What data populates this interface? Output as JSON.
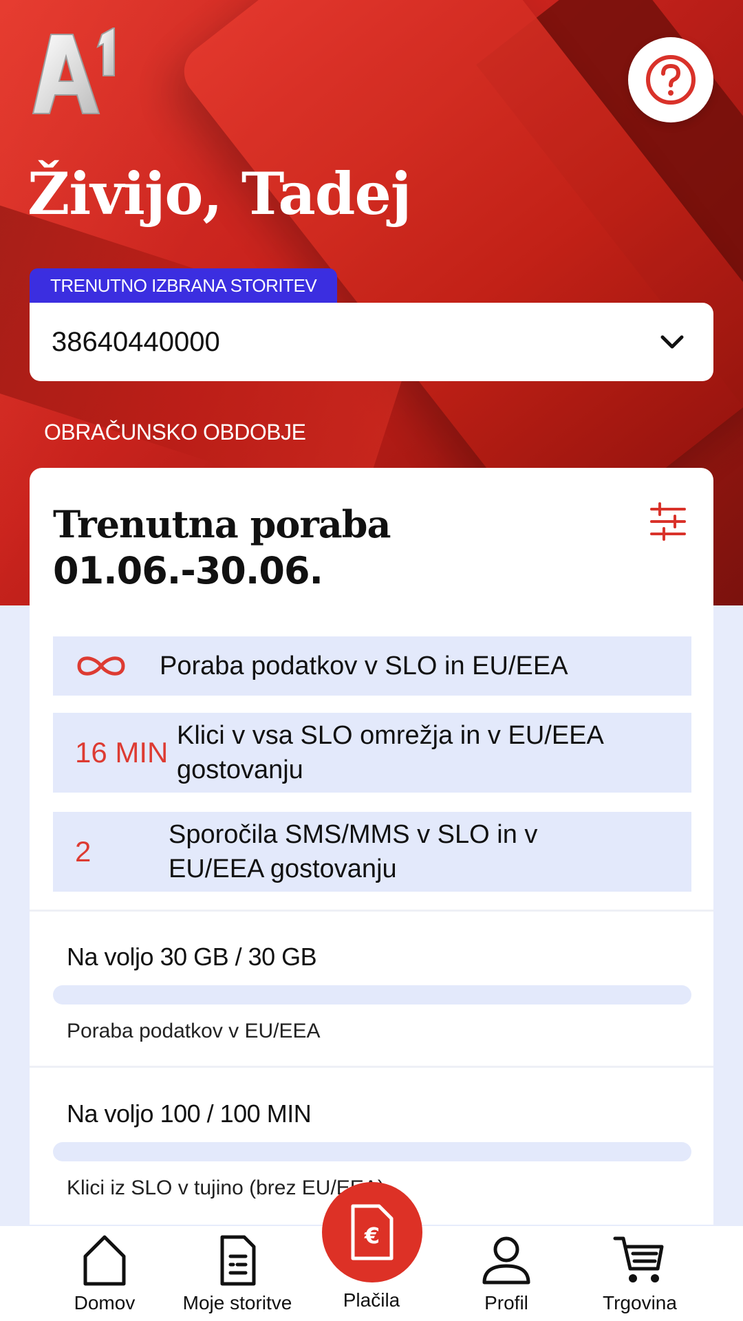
{
  "header": {
    "greeting": "Živijo, Tadej",
    "help_icon": "question-circle-icon"
  },
  "service": {
    "tag_label": "TRENUTNO IZBRANA STORITEV",
    "selected_number": "38640440000",
    "dropdown_icon": "chevron-down-icon"
  },
  "period": {
    "label": "OBRAČUNSKO OBDOBJE"
  },
  "usage_card": {
    "title": "Trenutna poraba",
    "date_range": "01.06.-30.06.",
    "filter_icon": "sliders-icon",
    "rows": [
      {
        "value": "",
        "icon": "infinity-icon",
        "label": "Poraba podatkov v SLO in EU/EEA"
      },
      {
        "value": "16 MIN",
        "label": "Klici v vsa SLO omrežja in v EU/EEA gostovanju"
      },
      {
        "value": "2",
        "label": "Sporočila SMS/MMS v SLO in v EU/EEA gostovanju"
      }
    ],
    "allowances": [
      {
        "available": "Na voljo 30 GB / 30 GB",
        "used_fraction": 0,
        "description": "Poraba podatkov v EU/EEA"
      },
      {
        "available": "Na voljo 100 / 100 MIN",
        "used_fraction": 0,
        "description": "Klici iz SLO v tujino (brez EU/EEA)"
      }
    ]
  },
  "bottom_nav": {
    "items": [
      {
        "label": "Domov",
        "icon": "home-icon"
      },
      {
        "label": "Moje storitve",
        "icon": "document-list-icon"
      },
      {
        "label": "Plačila",
        "icon": "euro-document-icon"
      },
      {
        "label": "Profil",
        "icon": "user-icon"
      },
      {
        "label": "Trgovina",
        "icon": "cart-icon"
      }
    ]
  },
  "colors": {
    "brand_red": "#dd3126",
    "accent_blue": "#3b2ee0",
    "row_bg": "#e3e9fb"
  }
}
